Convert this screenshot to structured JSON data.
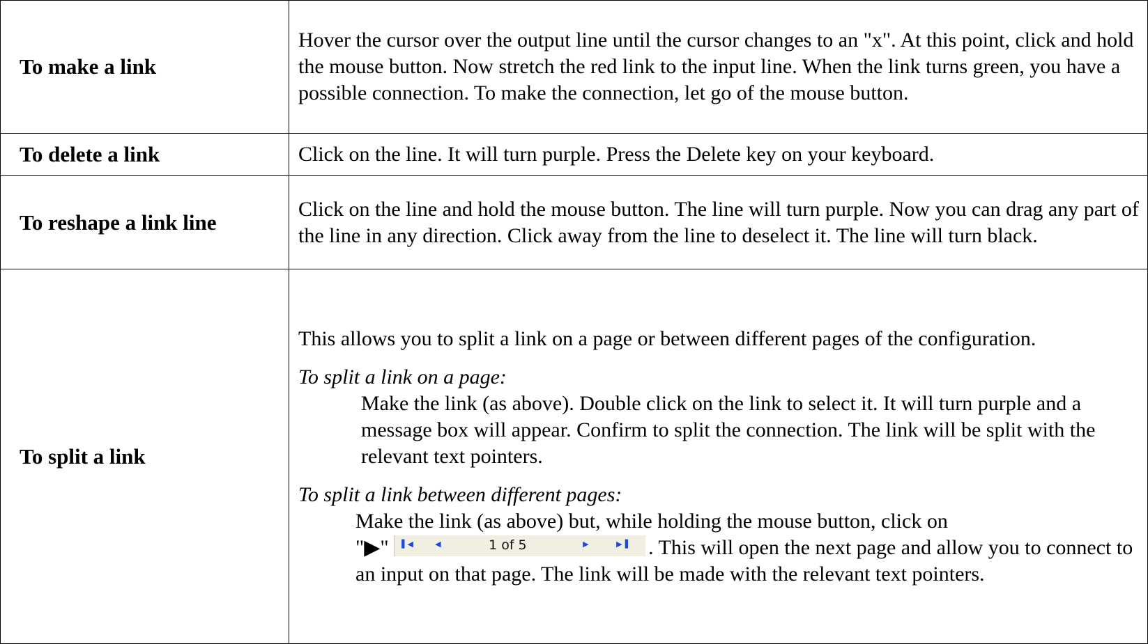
{
  "rows": [
    {
      "label": "To make a link",
      "text": "Hover the cursor over the output line until the cursor changes to an \"x\". At this point, click and hold the mouse button. Now stretch the red link to the input line. When the link turns green, you have a possible connection. To make the connection, let go of the mouse button."
    },
    {
      "label": "To delete a link",
      "text": "Click on the line. It will turn purple. Press the Delete key on your keyboard."
    },
    {
      "label": "To reshape a link line",
      "text": "Click on the line and hold the mouse button. The line will turn purple. Now you can drag any part of the line in any direction. Click away from the line to deselect it. The line will turn black."
    },
    {
      "label": "To split a link",
      "intro": "This allows you to split a link on a page or between different pages of the configuration.",
      "on_page_heading": "To split a link on a page:",
      "on_page_text": "Make the link (as above). Double click on the link to select it. It will turn purple and a message box will appear. Confirm to split the connection. The link will be split with the relevant text pointers.",
      "between_heading": "To split a link between different pages:",
      "between_text_1": "Make the link (as above) but, while holding the mouse button, click on",
      "play_symbol": "\"▶\"",
      "between_text_2": ". This will open the next page and allow you to connect to an input on that page. The link will be made with the relevant text pointers."
    }
  ],
  "pager": {
    "first_icon": "first-page-icon",
    "prev_icon": "previous-page-icon",
    "next_icon": "next-page-icon",
    "last_icon": "last-page-icon",
    "page_info": "1 of 5"
  }
}
